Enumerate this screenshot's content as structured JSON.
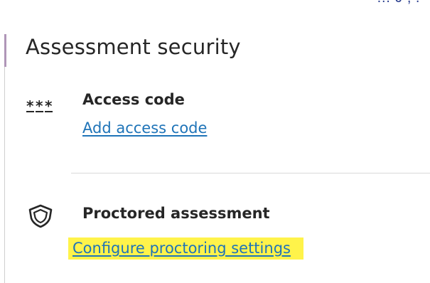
{
  "header": {
    "top_fragment": "… J , ."
  },
  "section": {
    "title": "Assessment security"
  },
  "access_code": {
    "icon": "asterisks-icon",
    "label": "Access code",
    "link": "Add access code"
  },
  "proctored": {
    "icon": "shield-icon",
    "label": "Proctored assessment",
    "link": "Configure proctoring settings",
    "highlight_color": "#fff34a"
  },
  "colors": {
    "link": "#1f74b8",
    "text": "#262626",
    "accent_bar": "#8e6a9a"
  }
}
